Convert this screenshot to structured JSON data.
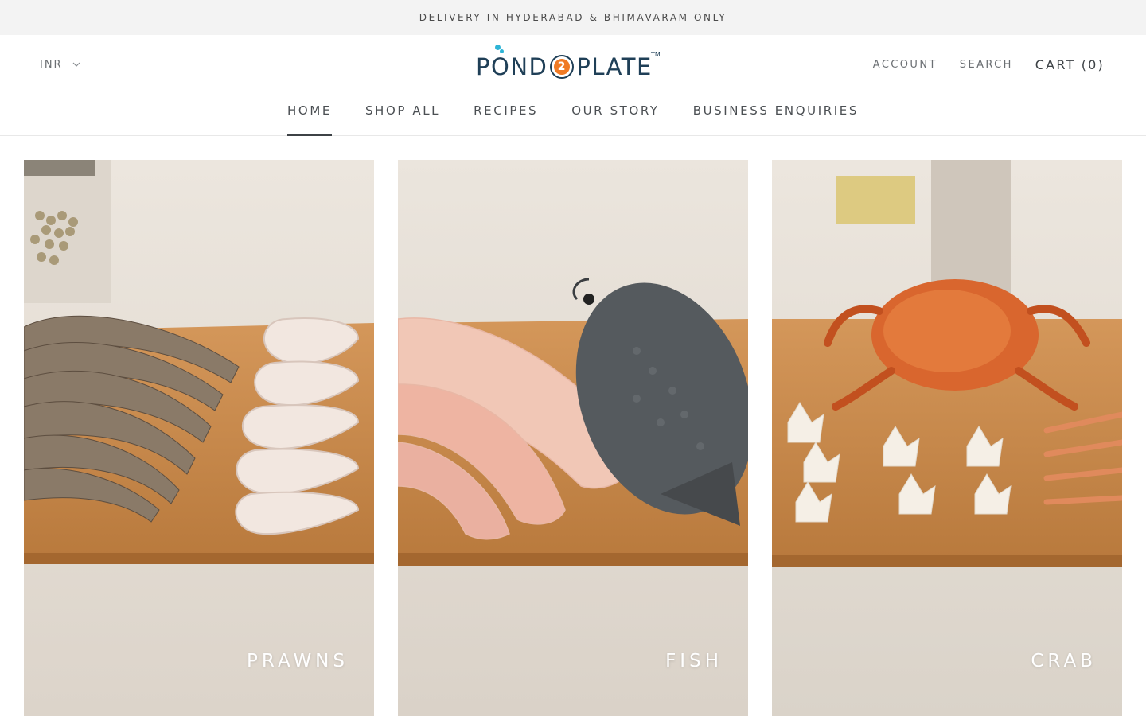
{
  "announcement": {
    "text": "DELIVERY IN HYDERABAD & BHIMAVARAM ONLY"
  },
  "header": {
    "currency": "INR",
    "logo": {
      "part1": "POND",
      "number": "2",
      "part2": "PLATE",
      "tm": "TM"
    },
    "account_label": "ACCOUNT",
    "search_label": "SEARCH",
    "cart_label": "CART (0)"
  },
  "nav": {
    "items": [
      {
        "label": "HOME",
        "active": true
      },
      {
        "label": "SHOP ALL"
      },
      {
        "label": "RECIPES"
      },
      {
        "label": "OUR STORY"
      },
      {
        "label": "BUSINESS ENQUIRIES"
      }
    ]
  },
  "collections": [
    {
      "label": "PRAWNS",
      "image": "prawns-on-cutting-board"
    },
    {
      "label": "FISH",
      "image": "fish-fillets-and-tilapia-on-cutting-board"
    },
    {
      "label": "CRAB",
      "image": "crab-and-crab-meat-on-cutting-board"
    }
  ],
  "colors": {
    "announcement_bg": "#f3f3f3",
    "logo_navy": "#1f3f57",
    "logo_orange": "#f07a24",
    "logo_blue_dot": "#2eb4d6",
    "board_wood": "#c98a45"
  }
}
